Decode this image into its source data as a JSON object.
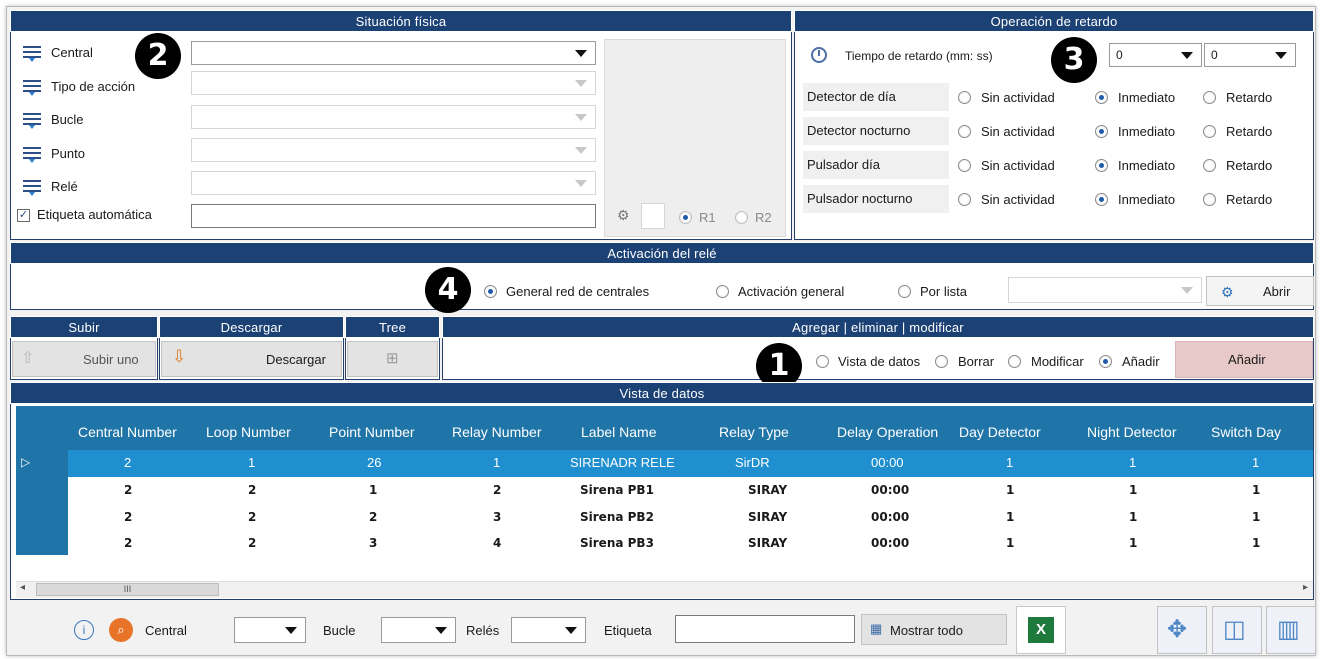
{
  "situacion": {
    "title": "Situación física",
    "fields": [
      {
        "label": "Central",
        "value": ""
      },
      {
        "label": "Tipo de acción",
        "value": ""
      },
      {
        "label": "Bucle",
        "value": ""
      },
      {
        "label": "Punto",
        "value": ""
      },
      {
        "label": "Relé",
        "value": ""
      }
    ],
    "auto_label": "Etiqueta automática",
    "auto_checked": true,
    "r1": "R1",
    "r2": "R2"
  },
  "operacion": {
    "title": "Operación de retardo",
    "tiempo_label": "Tiempo de retardo (mm: ss)",
    "min_value": "0",
    "sec_value": "0",
    "rows": [
      {
        "label": "Detector de día",
        "selected": "Inmediato"
      },
      {
        "label": "Detector nocturno",
        "selected": "Inmediato"
      },
      {
        "label": "Pulsador día",
        "selected": "Inmediato"
      },
      {
        "label": "Pulsador nocturno",
        "selected": "Inmediato"
      }
    ],
    "options": [
      "Sin actividad",
      "Inmediato",
      "Retardo"
    ]
  },
  "activacion": {
    "title": "Activación del relé",
    "options": [
      "General red de centrales",
      "Activación general",
      "Por lista"
    ],
    "selected": "General red de centrales",
    "abrir": "Abrir"
  },
  "toolbar": {
    "subir_title": "Subir",
    "subir_btn": "Subir uno",
    "descargar_title": "Descargar",
    "descargar_btn": "Descargar",
    "tree_title": "Tree",
    "agregar_title": "Agregar | eliminar | modificar",
    "modes": [
      "Vista de datos",
      "Borrar",
      "Modificar",
      "Añadir"
    ],
    "selected_mode": "Añadir",
    "anadir_btn": "Añadir"
  },
  "badges": [
    "1",
    "2",
    "3",
    "4"
  ],
  "vista": {
    "title": "Vista de datos",
    "columns": [
      "Central Number",
      "Loop Number",
      "Point Number",
      "Relay Number",
      "Label Name",
      "Relay Type",
      "Delay Operation",
      "Day Detector",
      "Night Detector",
      "Switch Day"
    ],
    "rows": [
      [
        "2",
        "1",
        "26",
        "1",
        "SIRENADR RELE",
        "SirDR",
        "00:00",
        "1",
        "1",
        "1"
      ],
      [
        "2",
        "2",
        "1",
        "2",
        "Sirena PB1",
        "SIRAY",
        "00:00",
        "1",
        "1",
        "1"
      ],
      [
        "2",
        "2",
        "2",
        "3",
        "Sirena PB2",
        "SIRAY",
        "00:00",
        "1",
        "1",
        "1"
      ],
      [
        "2",
        "2",
        "3",
        "4",
        "Sirena PB3",
        "SIRAY",
        "00:00",
        "1",
        "1",
        "1"
      ]
    ],
    "scroll_thumb": "III"
  },
  "footer": {
    "central_label": "Central",
    "bucle_label": "Bucle",
    "reles_label": "Relés",
    "etiqueta_label": "Etiqueta",
    "mostrar_btn": "Mostrar todo"
  },
  "colors": {
    "header": "#1c4175",
    "grid_header": "#1f75a8",
    "selected_row": "#1f8fcf",
    "anadir_bg": "#e8c9c9"
  }
}
